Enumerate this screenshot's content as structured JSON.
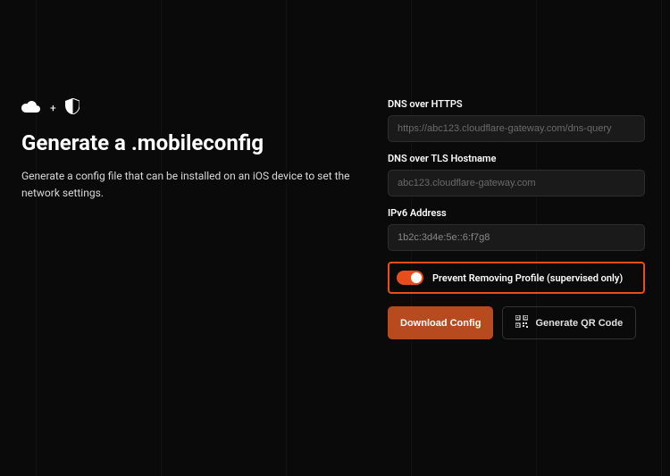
{
  "left": {
    "heading": "Generate a .mobileconfig",
    "description": "Generate a config file that can be installed on an iOS device to set the network settings."
  },
  "form": {
    "dns_https": {
      "label": "DNS over HTTPS",
      "placeholder": "https://abc123.cloudflare-gateway.com/dns-query"
    },
    "dns_tls": {
      "label": "DNS over TLS Hostname",
      "placeholder": "abc123.cloudflare-gateway.com"
    },
    "ipv6": {
      "label": "IPv6 Address",
      "value": "1b2c:3d4e:5e::6:f7g8"
    },
    "prevent_remove": {
      "label": "Prevent Removing Profile (supervised only)",
      "enabled": true
    },
    "download_label": "Download Config",
    "qr_label": "Generate QR Code"
  },
  "icons": {
    "cloud": "cloud-icon",
    "plus": "+",
    "shield": "shield-icon",
    "qr": "qr-icon"
  }
}
